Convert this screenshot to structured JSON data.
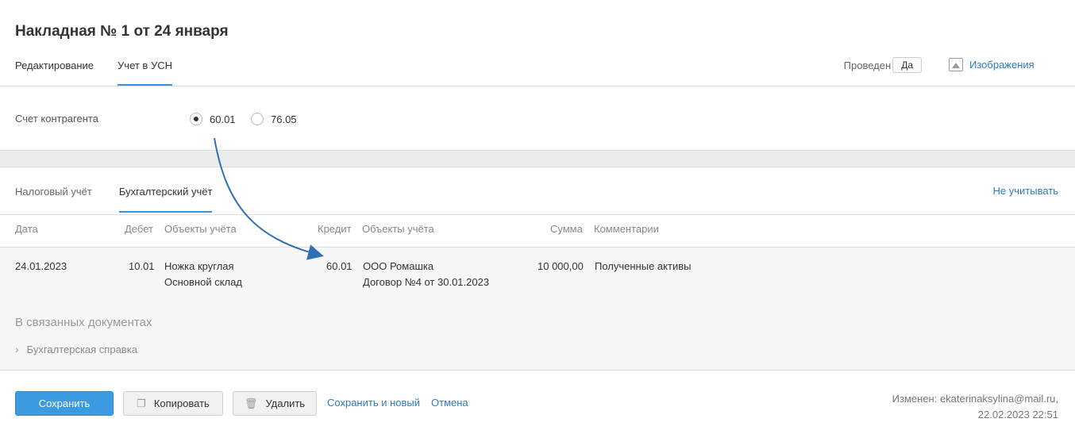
{
  "header": {
    "title": "Накладная № 1 от 24 января",
    "tabs": [
      {
        "label": "Редактирование",
        "active": false
      },
      {
        "label": "Учет в УСН",
        "active": true
      }
    ],
    "posted_label": "Проведен",
    "posted_value": "Да",
    "images_label": "Изображения"
  },
  "counterparty": {
    "label": "Счет контрагента",
    "options": [
      {
        "label": "60.01",
        "selected": true
      },
      {
        "label": "76.05",
        "selected": false
      }
    ]
  },
  "accounting_tabs": {
    "tabs": [
      {
        "label": "Налоговый учёт",
        "active": false
      },
      {
        "label": "Бухгалтерский учёт",
        "active": true
      }
    ],
    "not_count_label": "Не учитывать"
  },
  "table": {
    "columns": {
      "date": "Дата",
      "debit": "Дебет",
      "debit_objects": "Объекты учёта",
      "credit": "Кредит",
      "credit_objects": "Объекты учёта",
      "amount": "Сумма",
      "comment": "Комментарии"
    },
    "row": {
      "date": "24.01.2023",
      "debit": "10.01",
      "debit_object_1": "Ножка круглая",
      "debit_object_2": "Основной склад",
      "credit": "60.01",
      "credit_object_1": "ООО Ромашка",
      "credit_object_2": "Договор №4 от 30.01.2023",
      "amount": "10 000,00",
      "comment": "Полученные активы"
    }
  },
  "linked_docs": {
    "title": "В связанных документах",
    "items": [
      "Бухгалтерская справка"
    ]
  },
  "footer": {
    "save": "Сохранить",
    "copy": "Копировать",
    "delete": "Удалить",
    "save_new": "Сохранить и новый",
    "cancel": "Отмена",
    "modified_line1": "Изменен: ekaterinaksylina@mail.ru,",
    "modified_line2": "22.02.2023 22:51"
  },
  "colors": {
    "accent": "#3c9be0",
    "link": "#2b7bc1",
    "arrow": "#2f6fb3"
  }
}
